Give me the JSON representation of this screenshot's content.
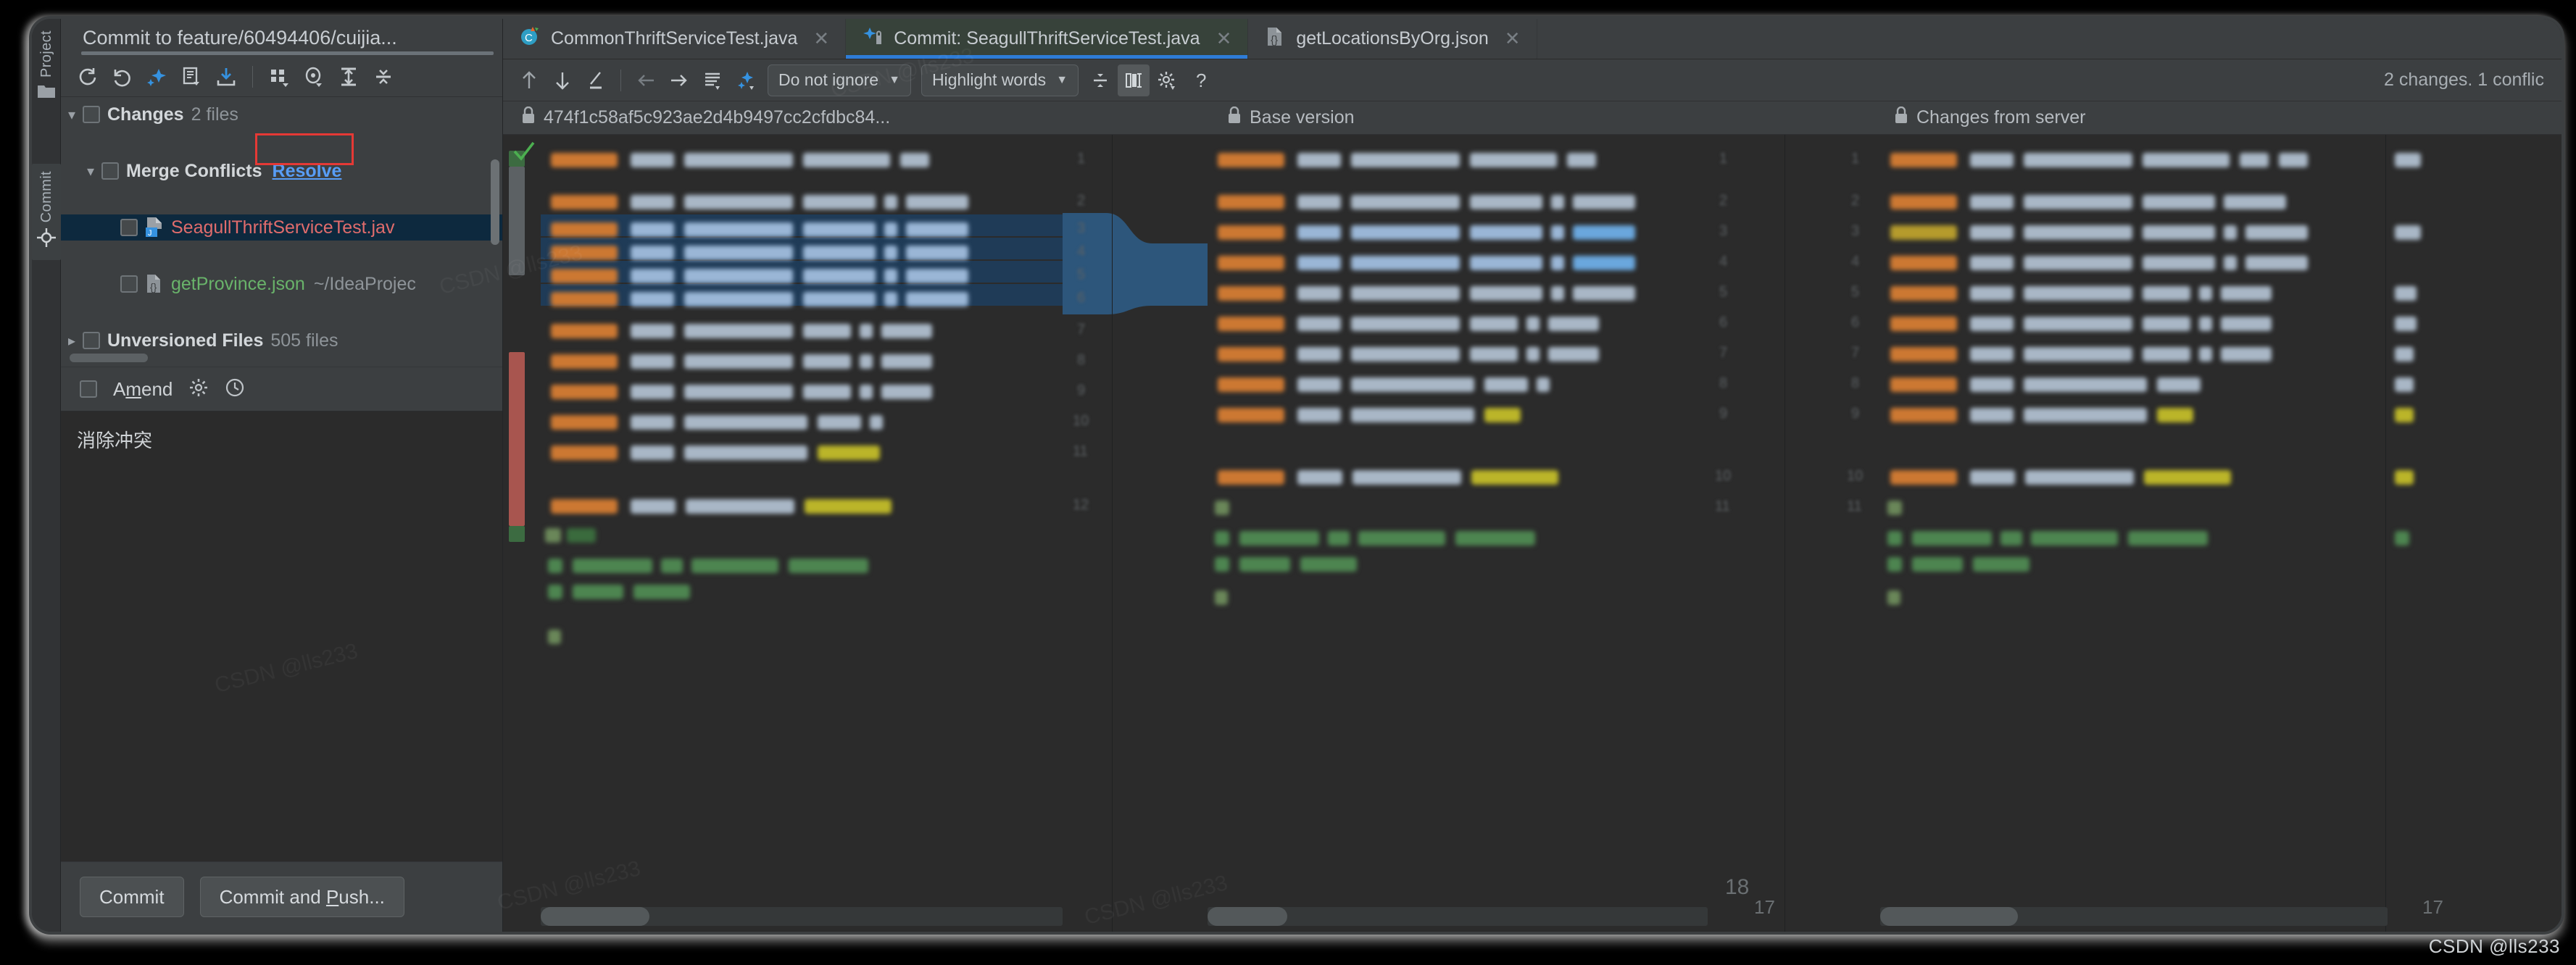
{
  "window": {
    "tool_strip": [
      {
        "id": "project",
        "label": "Project",
        "icon": "folder-icon"
      },
      {
        "id": "commit",
        "label": "Commit",
        "icon": "commit-node-icon"
      }
    ]
  },
  "commit_panel": {
    "title": "Commit to feature/60494406/cuijia...",
    "toolbar": [
      {
        "name": "refresh-changes-icon",
        "glyph": "refresh"
      },
      {
        "name": "rollback-icon",
        "glyph": "undo"
      },
      {
        "name": "shelve-silently-icon",
        "glyph": "shelve"
      },
      {
        "name": "show-diff-icon",
        "glyph": "diff"
      },
      {
        "name": "update-project-icon",
        "glyph": "download"
      },
      {
        "name": "group-by-icon",
        "glyph": "group"
      },
      {
        "name": "preview-diff-icon",
        "glyph": "eye"
      },
      {
        "name": "expand-all-icon",
        "glyph": "expand"
      },
      {
        "name": "collapse-all-icon",
        "glyph": "collapse"
      }
    ],
    "tree": [
      {
        "indent": 0,
        "arrow": "down",
        "label": "Changes",
        "sub": "2 files",
        "kind": "group"
      },
      {
        "indent": 1,
        "arrow": "down",
        "label": "Merge Conflicts",
        "link": "Resolve",
        "kind": "group"
      },
      {
        "indent": 2,
        "arrow": "none",
        "label": "SeagullThriftServiceTest.jav",
        "kind": "file-java",
        "color": "red",
        "selected": true
      },
      {
        "indent": 2,
        "arrow": "none",
        "label": "getProvince.json",
        "path": "~/IdeaProjec",
        "kind": "file-json",
        "color": "green"
      },
      {
        "indent": 0,
        "arrow": "right",
        "label": "Unversioned Files",
        "sub": "505 files",
        "kind": "group"
      }
    ],
    "amend": {
      "label_before": "A",
      "label_mnemonic": "m",
      "label_after": "end",
      "checked": false,
      "gear_icon": "gear-icon",
      "history_icon": "clock-icon"
    },
    "message": "消除冲突",
    "buttons": [
      {
        "name": "commit-button",
        "label": "Commit"
      },
      {
        "name": "commit-and-push-button",
        "label_before": "Commit and ",
        "label_mnemonic": "P",
        "label_after": "ush..."
      }
    ]
  },
  "tabs": [
    {
      "label": "CommonThriftServiceTest.java",
      "icon": "class-icon",
      "active": false,
      "closable": true
    },
    {
      "label": "Commit: SeagullThriftServiceTest.java",
      "icon": "merge-conflict-icon",
      "active": true,
      "closable": true
    },
    {
      "label": "getLocationsByOrg.json",
      "icon": "json-icon",
      "active": false,
      "closable": true
    }
  ],
  "diff_toolbar": {
    "icons": [
      {
        "name": "previous-difference-icon",
        "glyph": "arrow-up"
      },
      {
        "name": "next-difference-icon",
        "glyph": "arrow-down"
      },
      {
        "name": "apply-non-conflicting-icon",
        "glyph": "pencil"
      },
      {
        "name": "accept-left-icon",
        "glyph": "arrow-left"
      },
      {
        "name": "accept-right-icon",
        "glyph": "arrow-right"
      },
      {
        "name": "magic-resolve-icon",
        "glyph": "lines"
      },
      {
        "name": "resolve-conflicts-icon",
        "glyph": "spark"
      }
    ],
    "ignore_policy": "Do not ignore",
    "highlight_mode": "Highlight words",
    "right_icons": [
      {
        "name": "collapse-unchanged-icon",
        "glyph": "collapse"
      },
      {
        "name": "editor-layout-icon",
        "glyph": "columns",
        "active": true
      },
      {
        "name": "diff-settings-icon",
        "glyph": "gear"
      },
      {
        "name": "help-icon",
        "glyph": "question"
      }
    ],
    "status": "2 changes. 1 conflic"
  },
  "diff_titles": [
    {
      "name": "diff-title-left",
      "icon": "lock-icon",
      "label": "474f1c58af5c923ae2d4b9497cc2cfdbc84..."
    },
    {
      "name": "diff-title-center",
      "icon": "lock-icon",
      "label": "Base version"
    },
    {
      "name": "diff-title-right",
      "icon": "lock-icon",
      "label": "Changes from server"
    }
  ],
  "diff_body": {
    "line_numbers_center": [
      "18",
      "17"
    ],
    "line_numbers_right": [
      "17"
    ]
  },
  "watermark": "CSDN @lls233",
  "colors": {
    "accent_blue": "#2e7cd6",
    "link_blue": "#589df6",
    "conflict_red": "#a8554f",
    "added_green": "#3a6b3d",
    "annotation_red": "#e53935",
    "selection_blue": "#0d293e",
    "keyword_orange": "#cc7832",
    "string_green": "#6a8759",
    "annotation_yellow": "#bbb529"
  }
}
